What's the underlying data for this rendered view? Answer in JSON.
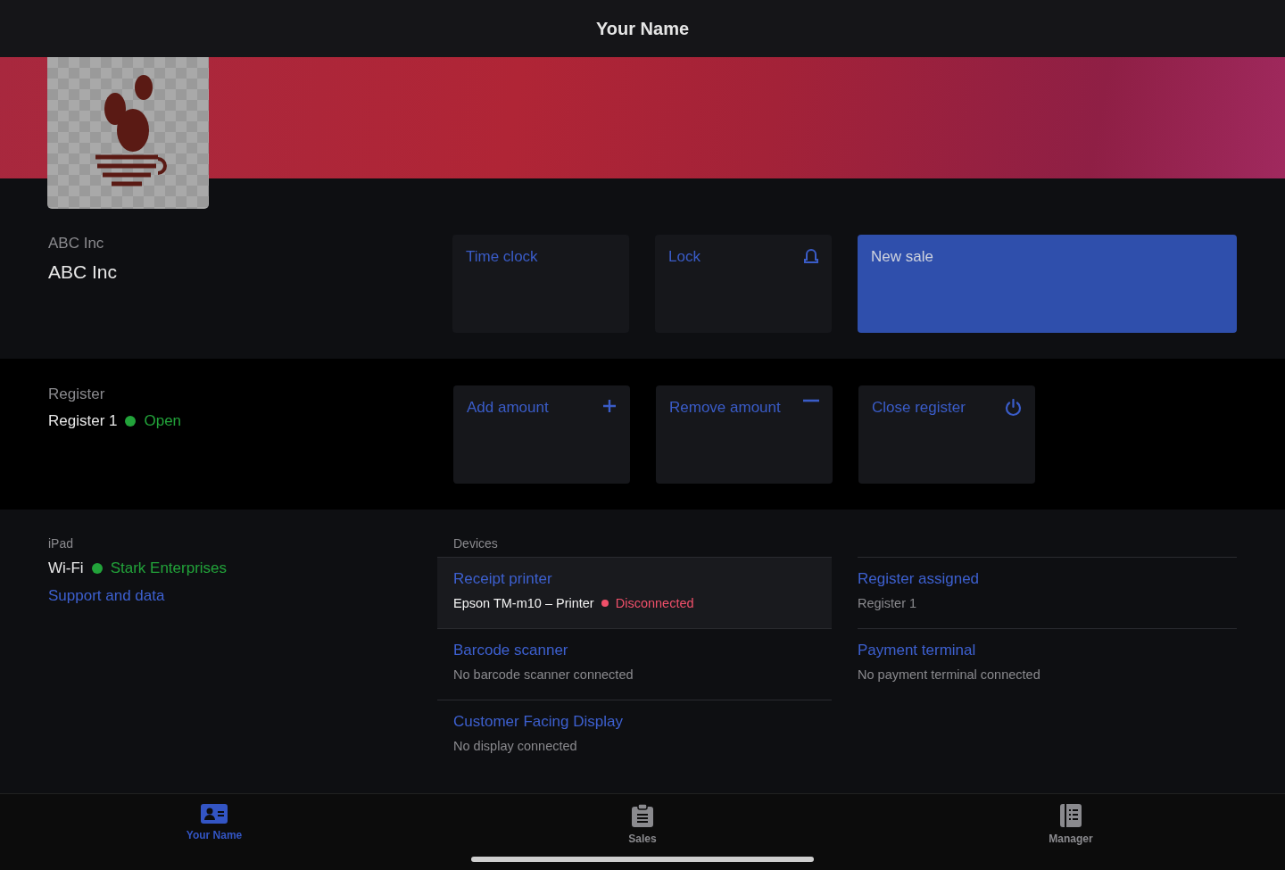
{
  "header": {
    "title": "Your Name"
  },
  "company": {
    "label": "ABC Inc",
    "name": "ABC Inc"
  },
  "company_actions": [
    {
      "kind": "plain",
      "label": "Time clock"
    },
    {
      "kind": "lock",
      "label": "Lock"
    },
    {
      "kind": "primary",
      "label": "New sale"
    }
  ],
  "register": {
    "label": "Register",
    "name": "Register 1",
    "status": "Open",
    "color": "#22a33a"
  },
  "register_actions": [
    {
      "kind": "add",
      "label": "Add amount"
    },
    {
      "kind": "remove",
      "label": "Remove amount"
    },
    {
      "kind": "power",
      "label": "Close register"
    }
  ],
  "ipad": {
    "label": "iPad",
    "wifi_label": "Wi-Fi",
    "network": "Stark Enterprises",
    "color": "#22a33a",
    "link": "Support and data"
  },
  "devices": {
    "title": "Devices",
    "left": [
      {
        "name": "Receipt printer",
        "detail": "Epson TM-m10 – Printer",
        "status": "Disconnected",
        "color": "#f0506a",
        "selected": true
      },
      {
        "name": "Barcode scanner",
        "detail": "No barcode scanner connected",
        "selected": false
      },
      {
        "name": "Customer Facing Display",
        "detail": "No display connected",
        "selected": false
      }
    ],
    "right": [
      {
        "name": "Register assigned",
        "detail": "Register 1",
        "selected": false
      },
      {
        "name": "Payment terminal",
        "detail": "No payment terminal connected",
        "selected": false
      }
    ]
  },
  "tabs": [
    {
      "kind": "card",
      "label": "Your Name",
      "selected": true
    },
    {
      "kind": "clipboard",
      "label": "Sales",
      "selected": false
    },
    {
      "kind": "book",
      "label": "Manager",
      "selected": false
    }
  ]
}
